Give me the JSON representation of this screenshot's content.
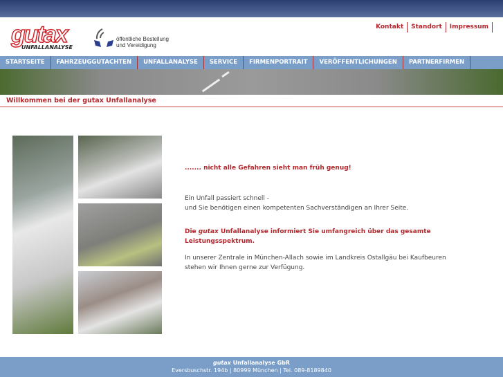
{
  "logo": {
    "brand": "gutax",
    "sub": "UNFALLANALYSE"
  },
  "seal": {
    "line1": "öffentliche Bestellung",
    "line2": "und Vereidigung"
  },
  "toplinks": [
    "Kontakt",
    "Standort",
    "Impressum"
  ],
  "nav": [
    "STARTSEITE",
    "FAHRZEUGGUTACHTEN",
    "UNFALLANALYSE",
    "SERVICE",
    "FIRMENPORTRAIT",
    "VERÖFFENTLICHUNGEN",
    "PARTNERFIRMEN"
  ],
  "welcome": "Willkommen bei der gutax Unfallanalyse",
  "content": {
    "tagline": "....... nicht alle Gefahren sieht man früh genug!",
    "p1a": "Ein Unfall passiert schnell -",
    "p1b": "und Sie benötigen einen kompetenten Sachverständigen an Ihrer Seite.",
    "p2_pre": "Die ",
    "p2_brand": "gutax",
    "p2_post": " Unfallanalyse informiert Sie umfangreich über das gesamte Leistungsspektrum.",
    "p3": "In unserer Zentrale in München-Allach sowie im Landkreis Ostallgäu bei Kaufbeuren stehen wir Ihnen gerne zur Verfügung."
  },
  "footer": {
    "brand": "gutax",
    "company": " Unfallanalyse GbR",
    "address": "Eversbuschstr. 194b | 80999 München | Tel. 089-8189840"
  }
}
